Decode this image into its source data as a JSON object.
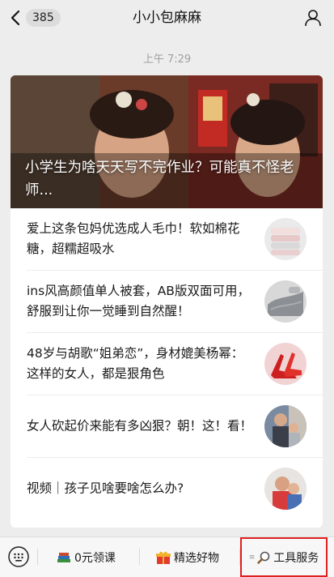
{
  "header": {
    "unread_count": "385",
    "title": "小小包麻麻"
  },
  "timestamp": "上午 7:29",
  "hero": {
    "title": "小学生为啥天天写不完作业？可能真不怪老师..."
  },
  "articles": [
    {
      "title": "爱上这条包妈优选成人毛巾！软如棉花糖，超糯超吸水",
      "thumb": "towels"
    },
    {
      "title": "ins风高颜值单人被套，AB版双面可用，舒服到让你一觉睡到自然醒！",
      "thumb": "bedding"
    },
    {
      "title": "48岁与胡歌“姐弟恋”，身材媲美杨幂：这样的女人，都是狠角色",
      "thumb": "red-high-heels"
    },
    {
      "title": "女人砍起价来能有多凶狠？朝！这！看！",
      "thumb": "mother-child"
    },
    {
      "title": "视频｜孩子见啥要啥怎么办?",
      "thumb": "child-hug"
    }
  ],
  "menu": {
    "item1": {
      "label": "0元领课",
      "icon": "books-icon"
    },
    "item2": {
      "label": "精选好物",
      "icon": "gift-icon"
    },
    "item3": {
      "label": "工具服务",
      "icon": "search-icon"
    }
  },
  "colors": {
    "background": "#ededed",
    "card": "#ffffff",
    "highlight_border": "#e02020"
  }
}
